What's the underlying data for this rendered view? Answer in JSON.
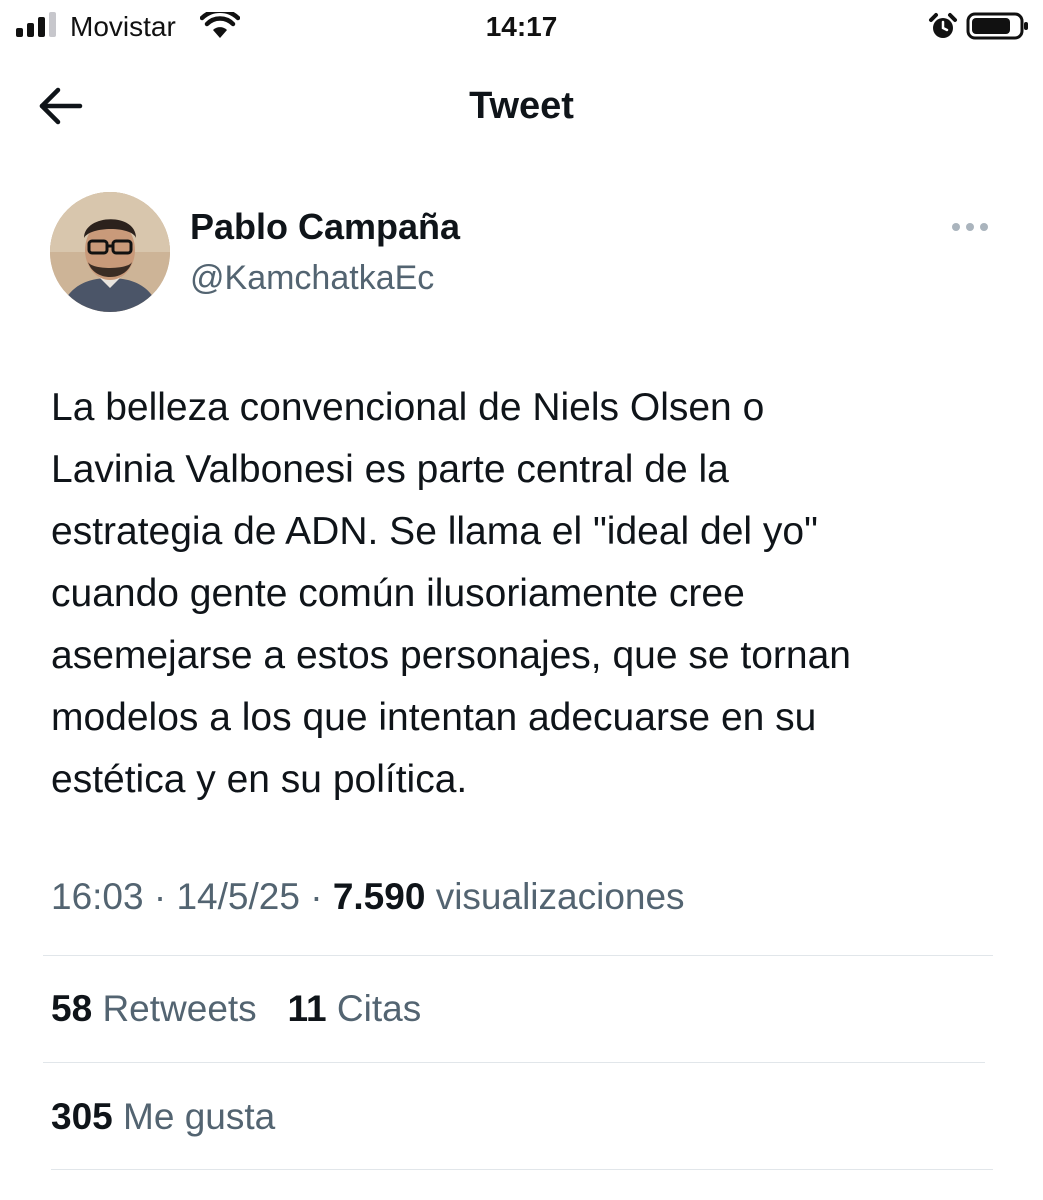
{
  "status_bar": {
    "carrier": "Movistar",
    "time": "14:17",
    "icons": [
      "signal-icon",
      "wifi-icon",
      "alarm-icon",
      "battery-icon"
    ]
  },
  "header": {
    "title": "Tweet",
    "back_icon": "back-arrow-icon"
  },
  "tweet": {
    "author_name": "Pablo Campaña",
    "author_handle": "@KamchatkaEc",
    "more_icon": "more-dots-icon",
    "text_lines": [
      "La belleza convencional de Niels Olsen o",
      "Lavinia Valbonesi es parte central de la",
      "estrategia de ADN. Se llama el \"ideal del yo\"",
      "cuando gente común ilusoriamente cree",
      "asemejarse a estos personajes, que se tornan",
      "modelos a los que intentan adecuarse en su",
      "estética y en su política."
    ],
    "time": "16:03",
    "separator": "·",
    "date": "14/5/25",
    "views_count": "7.590",
    "views_label": "visualizaciones"
  },
  "stats": {
    "retweets_count": "58",
    "retweets_label": "Retweets",
    "quotes_count": "11",
    "quotes_label": "Citas",
    "likes_count": "305",
    "likes_label": "Me gusta"
  },
  "colors": {
    "text_primary": "#0f1419",
    "text_secondary": "#536471",
    "divider": "#e1e6ea"
  }
}
